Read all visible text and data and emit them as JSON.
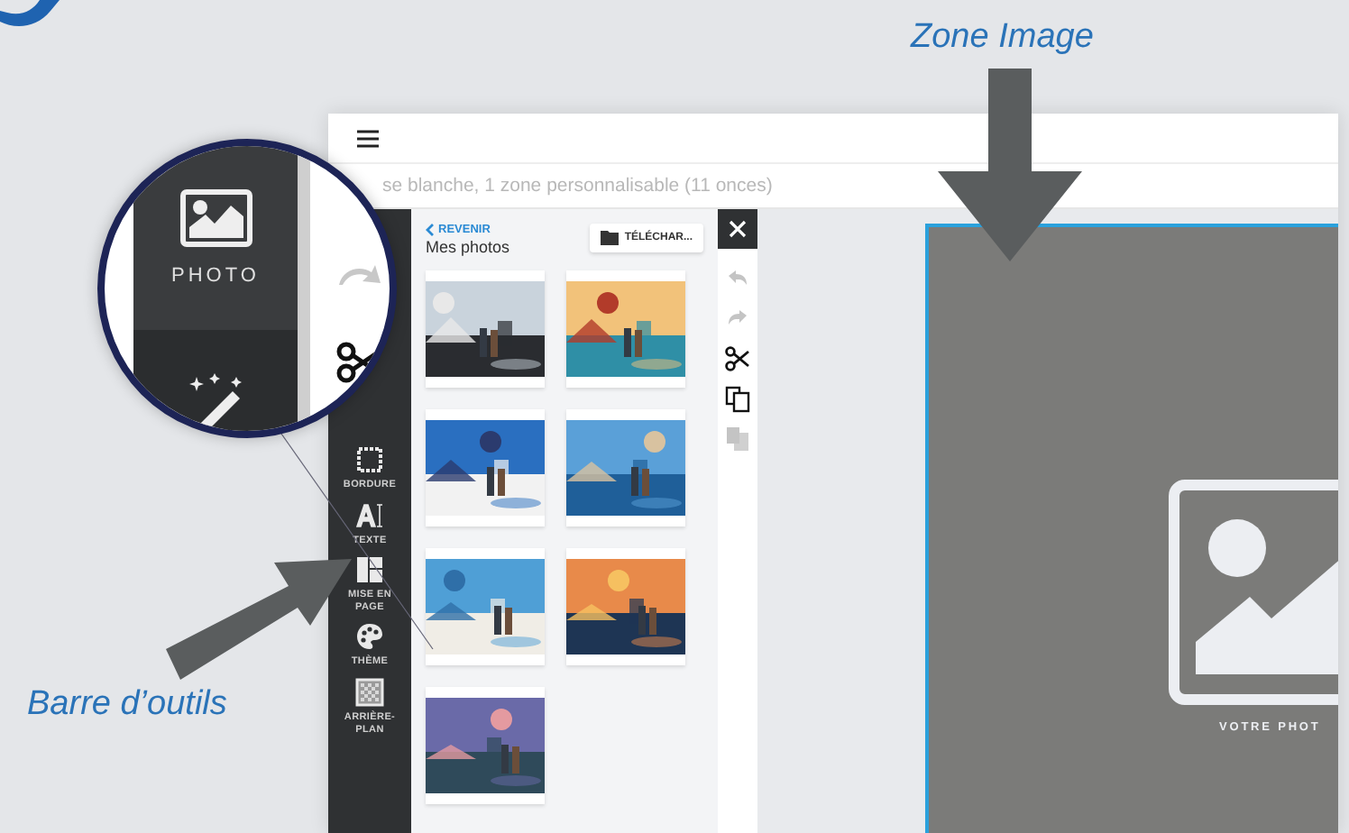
{
  "annotations": [
    {
      "kind": "zone",
      "text": "Zone Image"
    },
    {
      "kind": "toolbar",
      "text": "Barre d’outils"
    }
  ],
  "window": {
    "subtitle": "se blanche, 1 zone personnalisable (11 onces)"
  },
  "magnifier": {
    "label": "PHOTO"
  },
  "toolbar": {
    "items": [
      {
        "kind": "border",
        "label": "BORDURE"
      },
      {
        "kind": "text",
        "label": "TEXTE"
      },
      {
        "kind": "layout",
        "label": "MISE EN PAGE"
      },
      {
        "kind": "theme",
        "label": "THÈME"
      },
      {
        "kind": "background",
        "label": "ARRIÈRE-PLAN"
      }
    ]
  },
  "panel": {
    "back": "REVENIR",
    "title": "Mes photos",
    "upload": "TÉLÉCHAR..."
  },
  "side_tools": [
    {
      "kind": "undo",
      "disabled": true
    },
    {
      "kind": "redo",
      "disabled": true
    },
    {
      "kind": "cut",
      "disabled": false
    },
    {
      "kind": "copy",
      "disabled": false
    },
    {
      "kind": "paste",
      "disabled": true
    }
  ],
  "image_zone": {
    "caption": "VOTRE PHOT"
  }
}
